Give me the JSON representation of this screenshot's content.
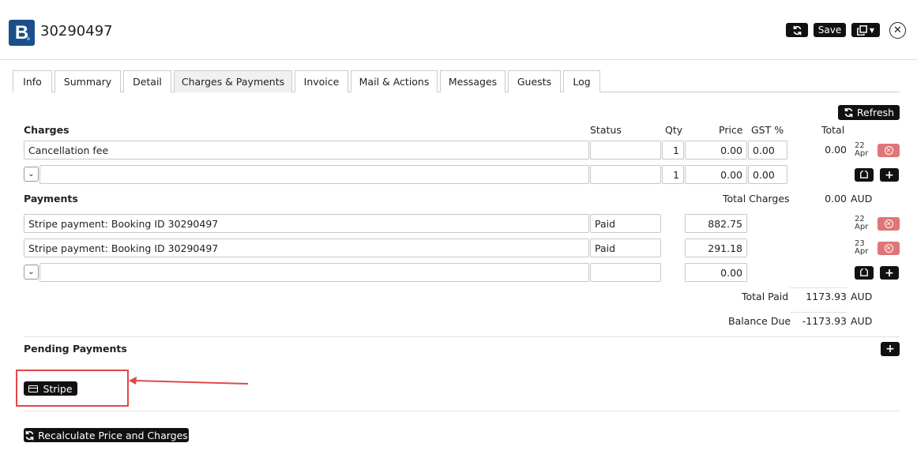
{
  "header": {
    "logo_letter": "B",
    "booking_id": "30290497",
    "save_label": "Save"
  },
  "tabs": [
    {
      "label": "Info"
    },
    {
      "label": "Summary"
    },
    {
      "label": "Detail"
    },
    {
      "label": "Charges & Payments",
      "active": true
    },
    {
      "label": "Invoice"
    },
    {
      "label": "Mail & Actions"
    },
    {
      "label": "Messages"
    },
    {
      "label": "Guests"
    },
    {
      "label": "Log"
    }
  ],
  "refresh_label": "Refresh",
  "charges": {
    "heading": "Charges",
    "columns": {
      "status": "Status",
      "qty": "Qty",
      "price": "Price",
      "gst": "GST %",
      "total": "Total"
    },
    "rows": [
      {
        "description": "Cancellation fee",
        "status": "",
        "qty": "1",
        "price": "0.00",
        "gst": "0.00",
        "total": "0.00",
        "date_day": "22",
        "date_month": "Apr"
      }
    ],
    "new_row": {
      "description": "",
      "status": "",
      "qty": "1",
      "price": "0.00",
      "gst": "0.00"
    },
    "total_label": "Total Charges",
    "total_value": "0.00",
    "currency": "AUD"
  },
  "payments": {
    "heading": "Payments",
    "rows": [
      {
        "description": "Stripe payment: Booking ID 30290497",
        "status": "Paid",
        "amount": "882.75",
        "date_day": "22",
        "date_month": "Apr"
      },
      {
        "description": "Stripe payment: Booking ID 30290497",
        "status": "Paid",
        "amount": "291.18",
        "date_day": "23",
        "date_month": "Apr"
      }
    ],
    "new_row": {
      "description": "",
      "status": "",
      "amount": "0.00"
    },
    "total_paid_label": "Total Paid",
    "total_paid_value": "1173.93",
    "balance_due_label": "Balance Due",
    "balance_due_value": "-1173.93",
    "currency": "AUD"
  },
  "pending": {
    "heading": "Pending Payments",
    "stripe_label": "Stripe"
  },
  "recalc_label": "Recalculate Price and Charges",
  "colors": {
    "button_bg": "#111111",
    "delete_bg": "#e07575",
    "annotation_red": "#e04848",
    "logo_blue": "#1b4f8a"
  }
}
